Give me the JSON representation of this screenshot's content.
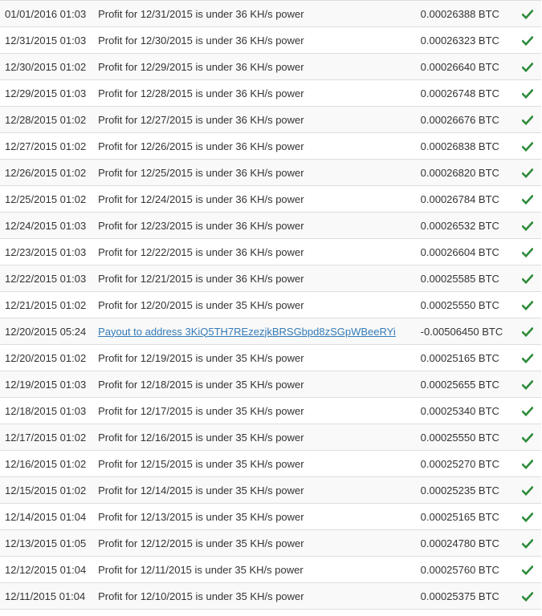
{
  "colors": {
    "check": "#2e8b3a",
    "link": "#337ab7",
    "row_stripe": "#f9f9f9",
    "border": "#dddddd"
  },
  "status_icon": "check-icon",
  "transactions": [
    {
      "date": "01/01/2016 01:03",
      "description": "Profit for 12/31/2015 is under 36 KH/s power",
      "amount": "0.00026388 BTC",
      "is_link": false
    },
    {
      "date": "12/31/2015 01:03",
      "description": "Profit for 12/30/2015 is under 36 KH/s power",
      "amount": "0.00026323 BTC",
      "is_link": false
    },
    {
      "date": "12/30/2015 01:02",
      "description": "Profit for 12/29/2015 is under 36 KH/s power",
      "amount": "0.00026640 BTC",
      "is_link": false
    },
    {
      "date": "12/29/2015 01:03",
      "description": "Profit for 12/28/2015 is under 36 KH/s power",
      "amount": "0.00026748 BTC",
      "is_link": false
    },
    {
      "date": "12/28/2015 01:02",
      "description": "Profit for 12/27/2015 is under 36 KH/s power",
      "amount": "0.00026676 BTC",
      "is_link": false
    },
    {
      "date": "12/27/2015 01:02",
      "description": "Profit for 12/26/2015 is under 36 KH/s power",
      "amount": "0.00026838 BTC",
      "is_link": false
    },
    {
      "date": "12/26/2015 01:02",
      "description": "Profit for 12/25/2015 is under 36 KH/s power",
      "amount": "0.00026820 BTC",
      "is_link": false
    },
    {
      "date": "12/25/2015 01:02",
      "description": "Profit for 12/24/2015 is under 36 KH/s power",
      "amount": "0.00026784 BTC",
      "is_link": false
    },
    {
      "date": "12/24/2015 01:03",
      "description": "Profit for 12/23/2015 is under 36 KH/s power",
      "amount": "0.00026532 BTC",
      "is_link": false
    },
    {
      "date": "12/23/2015 01:03",
      "description": "Profit for 12/22/2015 is under 36 KH/s power",
      "amount": "0.00026604 BTC",
      "is_link": false
    },
    {
      "date": "12/22/2015 01:03",
      "description": "Profit for 12/21/2015 is under 36 KH/s power",
      "amount": "0.00025585 BTC",
      "is_link": false
    },
    {
      "date": "12/21/2015 01:02",
      "description": "Profit for 12/20/2015 is under 35 KH/s power",
      "amount": "0.00025550 BTC",
      "is_link": false
    },
    {
      "date": "12/20/2015 05:24",
      "description": "Payout to address 3KiQ5TH7REzezjkBRSGbpd8zSGpWBeeRYi",
      "amount": "-0.00506450 BTC",
      "is_link": true
    },
    {
      "date": "12/20/2015 01:02",
      "description": "Profit for 12/19/2015 is under 35 KH/s power",
      "amount": "0.00025165 BTC",
      "is_link": false
    },
    {
      "date": "12/19/2015 01:03",
      "description": "Profit for 12/18/2015 is under 35 KH/s power",
      "amount": "0.00025655 BTC",
      "is_link": false
    },
    {
      "date": "12/18/2015 01:03",
      "description": "Profit for 12/17/2015 is under 35 KH/s power",
      "amount": "0.00025340 BTC",
      "is_link": false
    },
    {
      "date": "12/17/2015 01:02",
      "description": "Profit for 12/16/2015 is under 35 KH/s power",
      "amount": "0.00025550 BTC",
      "is_link": false
    },
    {
      "date": "12/16/2015 01:02",
      "description": "Profit for 12/15/2015 is under 35 KH/s power",
      "amount": "0.00025270 BTC",
      "is_link": false
    },
    {
      "date": "12/15/2015 01:02",
      "description": "Profit for 12/14/2015 is under 35 KH/s power",
      "amount": "0.00025235 BTC",
      "is_link": false
    },
    {
      "date": "12/14/2015 01:04",
      "description": "Profit for 12/13/2015 is under 35 KH/s power",
      "amount": "0.00025165 BTC",
      "is_link": false
    },
    {
      "date": "12/13/2015 01:05",
      "description": "Profit for 12/12/2015 is under 35 KH/s power",
      "amount": "0.00024780 BTC",
      "is_link": false
    },
    {
      "date": "12/12/2015 01:04",
      "description": "Profit for 12/11/2015 is under 35 KH/s power",
      "amount": "0.00025760 BTC",
      "is_link": false
    },
    {
      "date": "12/11/2015 01:04",
      "description": "Profit for 12/10/2015 is under 35 KH/s power",
      "amount": "0.00025375 BTC",
      "is_link": false
    }
  ]
}
